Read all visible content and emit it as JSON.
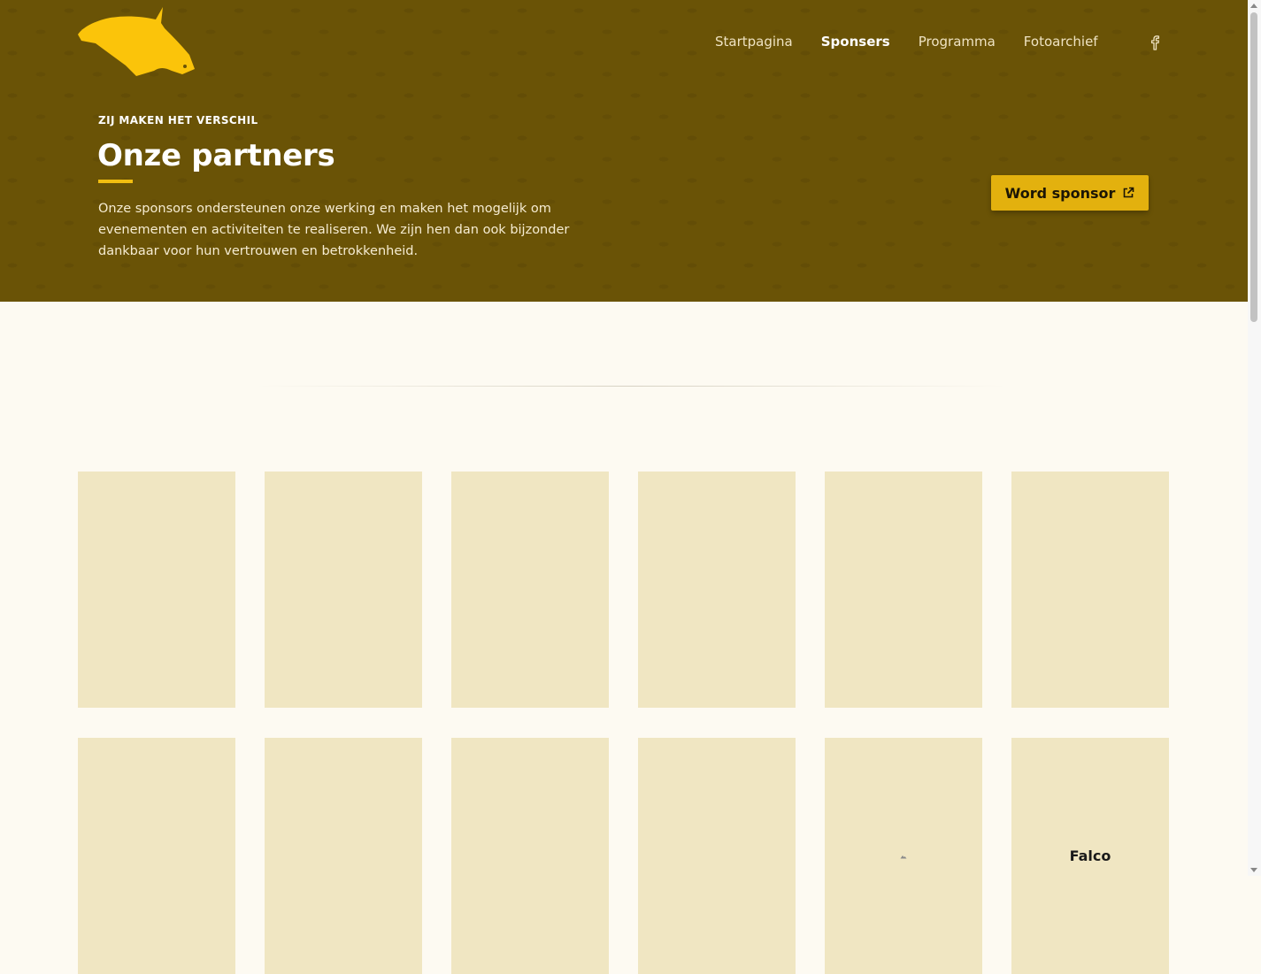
{
  "header": {
    "logo_icon": "horse-head-logo",
    "nav": [
      {
        "label": "Startpagina",
        "active": false
      },
      {
        "label": "Sponsers",
        "active": true
      },
      {
        "label": "Programma",
        "active": false
      },
      {
        "label": "Fotoarchief",
        "active": false
      }
    ],
    "social_icon": "facebook-icon"
  },
  "hero": {
    "eyebrow": "ZIJ MAKEN HET VERSCHIL",
    "title": "Onze partners",
    "intro": "Onze sponsors ondersteunen onze werking en maken het mogelijk om evenementen en activiteiten te realiseren. We zijn hen dan ook bijzonder dankbaar voor hun vertrouwen en betrokkenheid.",
    "cta_label": "Word sponsor",
    "cta_icon": "external-link-icon"
  },
  "sponsors": {
    "row1": [
      "",
      "",
      "",
      "",
      "",
      ""
    ],
    "row2": [
      "",
      "",
      "",
      "",
      "",
      "Falco"
    ]
  },
  "colors": {
    "hero_background": "#6a5306",
    "accent": "#e3b10e",
    "logo": "#fbc40a",
    "page_background": "#fdfaf2",
    "card_background": "#f0e6c2"
  }
}
